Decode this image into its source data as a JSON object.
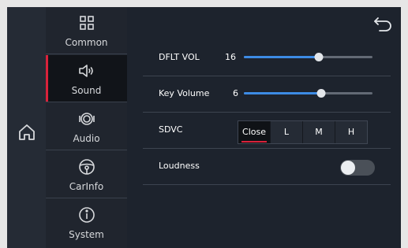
{
  "nav": {
    "items": [
      {
        "label": "Common",
        "icon": "grid-icon"
      },
      {
        "label": "Sound",
        "icon": "speaker-icon",
        "active": true
      },
      {
        "label": "Audio",
        "icon": "speaker-cone-icon"
      },
      {
        "label": "CarInfo",
        "icon": "steering-wheel-icon"
      },
      {
        "label": "System",
        "icon": "info-icon"
      }
    ]
  },
  "settings": {
    "dflt_vol": {
      "label": "DFLT VOL",
      "value": "16",
      "level": 0.58
    },
    "key_volume": {
      "label": "Key Volume",
      "value": "6",
      "level": 0.6
    },
    "sdvc": {
      "label": "SDVC",
      "options": [
        "Close",
        "L",
        "M",
        "H"
      ],
      "selected": "Close"
    },
    "loudness": {
      "label": "Loudness",
      "on": false
    }
  },
  "colors": {
    "accent": "#d9223b",
    "slider": "#3d8be5",
    "background": "#1d232d"
  }
}
